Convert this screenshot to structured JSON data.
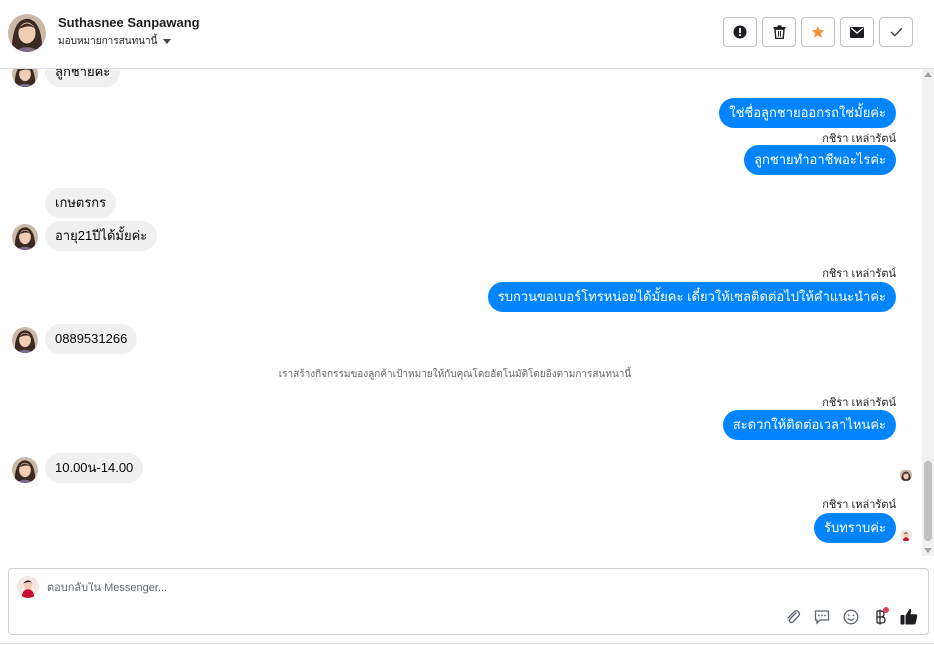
{
  "header": {
    "contact_name": "Suthasnee Sanpawang",
    "assign_label": "มอบหมายการสนทนานี้",
    "actions": [
      "spam-icon",
      "trash-icon",
      "star-icon",
      "envelope-icon",
      "check-icon"
    ],
    "star_color": "#f7923b"
  },
  "messages": {
    "in_1": "ลูกชายค่ะ",
    "out_1": "ใช่ชื่อลูกชายออกรถใช่มั้ยค่ะ",
    "sender_1": "กชิรา เหล่ารัตน์",
    "out_2": "ลูกชายทำอาชีพอะไรค่ะ",
    "in_2": "เกษตรกร",
    "in_3": "อายุ21ปีได้มั้ยค่ะ",
    "sender_2": "กชิรา เหล่ารัตน์",
    "out_3": "รบกวนขอเบอร์โทรหน่อยได้มั้ยคะ เดี๋ยวให้เซลติดต่อไปให้คำแนะนำค่ะ",
    "in_4": "0889531266",
    "system_note": "เราสร้างกิจกรรมของลูกค้าเป้าหมายให้กับคุณโดยอัตโนมัติโดยอิงตามการสนทนานี้",
    "sender_3": "กชิรา เหล่ารัตน์",
    "out_4": "สะดวกให้ติดต่อเวลาไหนค่ะ",
    "in_5": "10.00น-14.00",
    "sender_4": "กชิรา เหล่ารัตน์",
    "out_5": "รับทราบค่ะ"
  },
  "composer": {
    "placeholder": "ตอบกลับใน Messenger...",
    "tools": [
      "paperclip-icon",
      "saved-reply-icon",
      "emoji-icon",
      "baht-icon",
      "thumbs-up-icon"
    ]
  },
  "colors": {
    "outgoing_bubble": "#0084ff",
    "incoming_bubble": "#f0f0f0"
  }
}
